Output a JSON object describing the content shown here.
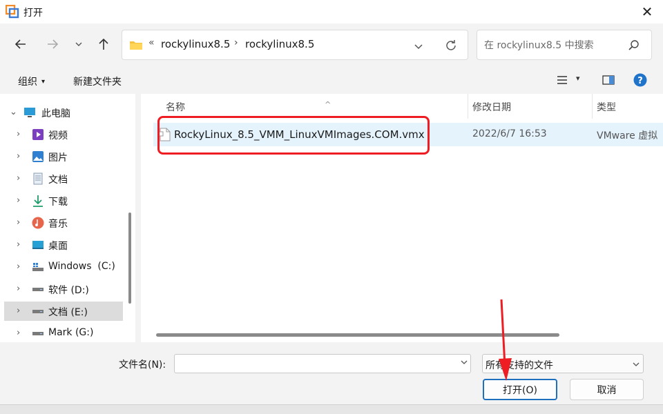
{
  "window": {
    "title": "打开",
    "close_label": "✕"
  },
  "nav": {
    "back_label": "←",
    "forward_label": "→",
    "recent_label": "⌄",
    "up_label": "↑"
  },
  "address": {
    "chevron": "«",
    "segments": [
      "rockylinux8.5",
      "rockylinux8.5"
    ],
    "separator": "›"
  },
  "search": {
    "placeholder": "在 rockylinux8.5 中搜索"
  },
  "toolbar": {
    "organize_label": "组织",
    "organize_caret": "▾",
    "new_folder_label": "新建文件夹",
    "view_caret": "▾",
    "help_label": "?"
  },
  "sidebar": {
    "items": [
      {
        "label": "此电脑",
        "chevron": "⌄",
        "icon": "computer-icon"
      },
      {
        "label": "视频",
        "chevron": "›",
        "icon": "video-icon"
      },
      {
        "label": "图片",
        "chevron": "›",
        "icon": "picture-icon"
      },
      {
        "label": "文档",
        "chevron": "›",
        "icon": "document-icon"
      },
      {
        "label": "下载",
        "chevron": "›",
        "icon": "download-icon"
      },
      {
        "label": "音乐",
        "chevron": "›",
        "icon": "music-icon"
      },
      {
        "label": "桌面",
        "chevron": "›",
        "icon": "desktop-icon"
      },
      {
        "label": "Windows  (C:)",
        "chevron": "›",
        "icon": "windows-drive-icon"
      },
      {
        "label": "软件 (D:)",
        "chevron": "›",
        "icon": "drive-icon"
      },
      {
        "label": "文档 (E:)",
        "chevron": "›",
        "icon": "drive-icon",
        "selected": true
      },
      {
        "label": "Mark (G:)",
        "chevron": "›",
        "icon": "drive-icon"
      }
    ]
  },
  "columns": {
    "name": "名称",
    "modified": "修改日期",
    "type": "类型",
    "sort_caret": "^"
  },
  "files": [
    {
      "name": "RockyLinux_8.5_VMM_LinuxVMImages.COM.vmx",
      "modified": "2022/6/7 16:53",
      "type": "VMware 虚拟"
    }
  ],
  "footer": {
    "filename_label": "文件名(N):",
    "filename_value": "",
    "filetype_value": "所有支持的文件",
    "open_label": "打开(O)",
    "cancel_label": "取消"
  },
  "colors": {
    "highlight_box": "#ee1d24",
    "arrow": "#ee1d24",
    "selected_row": "#e5f3fd",
    "primary_border": "#1f6fbf"
  }
}
